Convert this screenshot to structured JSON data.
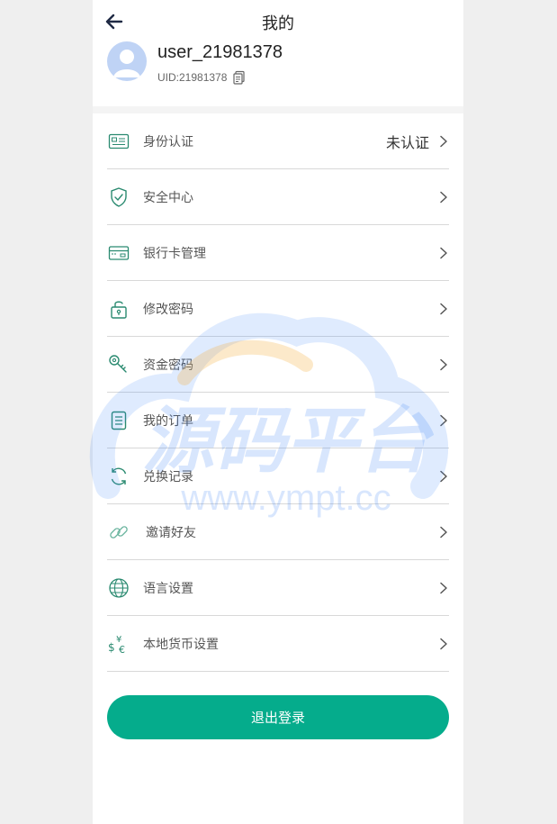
{
  "header": {
    "title": "我的"
  },
  "profile": {
    "username": "user_21981378",
    "uid": "UID:21981378"
  },
  "menu": [
    {
      "label": "身份认证",
      "status": "未认证",
      "icon": "id-card-icon"
    },
    {
      "label": "安全中心",
      "icon": "shield-icon"
    },
    {
      "label": "银行卡管理",
      "icon": "bank-card-icon"
    },
    {
      "label": "修改密码",
      "icon": "lock-icon"
    },
    {
      "label": "资金密码",
      "icon": "key-icon"
    },
    {
      "label": "我的订单",
      "icon": "order-icon"
    },
    {
      "label": "兑换记录",
      "icon": "refresh-icon"
    },
    {
      "label": "邀请好友",
      "icon": "link-icon"
    },
    {
      "label": "语言设置",
      "icon": "globe-icon"
    },
    {
      "label": "本地货币设置",
      "icon": "currency-icon"
    }
  ],
  "logout_label": "退出登录",
  "watermark": {
    "title": "源码平台",
    "url": "www.ympt.cc"
  },
  "colors": {
    "accent": "#05ac8c",
    "icon": "#2a8a70",
    "watermark": "#3b82f6"
  }
}
